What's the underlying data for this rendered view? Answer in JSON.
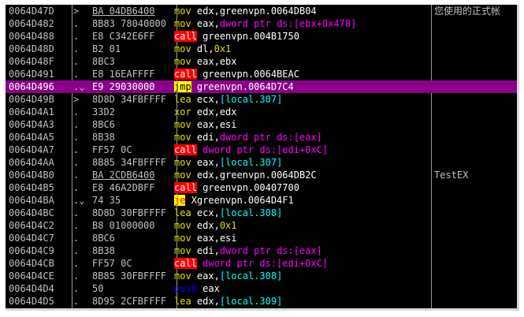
{
  "disasm": {
    "rows": [
      {
        "addr": "0064D47D",
        "mark": ">",
        "hex": "BA 04DB6400",
        "hex_ul": true,
        "op": "mov",
        "opclass": "op-y",
        "args": [
          [
            "w",
            "edx,greenvpn.0064DB04"
          ]
        ],
        "comment": "您使用的正式帐",
        "selected": false
      },
      {
        "addr": "0064D482",
        "mark": ".",
        "hex": "8B83 78040000",
        "hex_ul": false,
        "op": "mov",
        "opclass": "op-y",
        "args": [
          [
            "w",
            "eax,"
          ],
          [
            "m",
            "dword ptr ds:[ebx+0x478]"
          ]
        ],
        "comment": "",
        "selected": false
      },
      {
        "addr": "0064D488",
        "mark": ".",
        "hex": "E8 C342E6FF",
        "hex_ul": false,
        "op": "call",
        "opclass": "op-call",
        "args": [
          [
            "w",
            "greenvpn.004B1750"
          ]
        ],
        "comment": "",
        "selected": false
      },
      {
        "addr": "0064D48D",
        "mark": ".",
        "hex": "B2 01",
        "hex_ul": false,
        "op": "mov",
        "opclass": "op-y",
        "args": [
          [
            "w",
            "dl,"
          ],
          [
            "y",
            "0x1"
          ]
        ],
        "comment": "",
        "selected": false
      },
      {
        "addr": "0064D48F",
        "mark": ".",
        "hex": "8BC3",
        "hex_ul": false,
        "op": "mov",
        "opclass": "op-y",
        "args": [
          [
            "w",
            "eax,ebx"
          ]
        ],
        "comment": "",
        "selected": false
      },
      {
        "addr": "0064D491",
        "mark": ".",
        "hex": "E8 16EAFFFF",
        "hex_ul": false,
        "op": "call",
        "opclass": "op-call",
        "args": [
          [
            "w",
            "greenvpn.0064BEAC"
          ]
        ],
        "comment": "",
        "selected": false
      },
      {
        "addr": "0064D496",
        "mark": ".⌄",
        "hex": "E9 29030000",
        "hex_ul": false,
        "op": "jmp",
        "opclass": "op-jmp",
        "args": [
          [
            "w",
            "greenvpn.0064D7C4"
          ]
        ],
        "comment": "",
        "selected": true
      },
      {
        "addr": "0064D49B",
        "mark": ">",
        "hex": "8D8D 34FBFFFF",
        "hex_ul": false,
        "op": "lea",
        "opclass": "op-y",
        "args": [
          [
            "w",
            "ecx,"
          ],
          [
            "c",
            "[local.307]"
          ]
        ],
        "comment": "",
        "selected": false
      },
      {
        "addr": "0064D4A1",
        "mark": ".",
        "hex": "33D2",
        "hex_ul": false,
        "op": "xor",
        "opclass": "op-y",
        "args": [
          [
            "w",
            "edx,edx"
          ]
        ],
        "comment": "",
        "selected": false
      },
      {
        "addr": "0064D4A3",
        "mark": ".",
        "hex": "8BC6",
        "hex_ul": false,
        "op": "mov",
        "opclass": "op-y",
        "args": [
          [
            "w",
            "eax,esi"
          ]
        ],
        "comment": "",
        "selected": false
      },
      {
        "addr": "0064D4A5",
        "mark": ".",
        "hex": "8B38",
        "hex_ul": false,
        "op": "mov",
        "opclass": "op-y",
        "args": [
          [
            "w",
            "edi,"
          ],
          [
            "m",
            "dword ptr ds:[eax]"
          ]
        ],
        "comment": "",
        "selected": false
      },
      {
        "addr": "0064D4A7",
        "mark": ".",
        "hex": "FF57 0C",
        "hex_ul": false,
        "op": "call",
        "opclass": "op-call",
        "args": [
          [
            "m",
            "dword ptr ds:[edi+0xC]"
          ]
        ],
        "comment": "",
        "selected": false
      },
      {
        "addr": "0064D4AA",
        "mark": ".",
        "hex": "8B85 34FBFFFF",
        "hex_ul": false,
        "op": "mov",
        "opclass": "op-y",
        "args": [
          [
            "w",
            "eax,"
          ],
          [
            "c",
            "[local.307]"
          ]
        ],
        "comment": "",
        "selected": false
      },
      {
        "addr": "0064D4B0",
        "mark": ".",
        "hex": "BA 2CDB6400",
        "hex_ul": true,
        "op": "mov",
        "opclass": "op-y",
        "args": [
          [
            "w",
            "edx,greenvpn.0064DB2C"
          ]
        ],
        "comment": "TestEX",
        "selected": false
      },
      {
        "addr": "0064D4B5",
        "mark": ".",
        "hex": "E8 46A2DBFF",
        "hex_ul": false,
        "op": "call",
        "opclass": "op-call",
        "args": [
          [
            "w",
            "greenvpn.00407700"
          ]
        ],
        "comment": "",
        "selected": false
      },
      {
        "addr": "0064D4BA",
        "mark": ".⌄",
        "hex": "74 35",
        "hex_ul": false,
        "op": "je",
        "opclass": "op-je",
        "args": [
          [
            "w",
            "Xgreenvpn.0064D4F1"
          ]
        ],
        "comment": "",
        "selected": false
      },
      {
        "addr": "0064D4BC",
        "mark": ".",
        "hex": "8D8D 30FBFFFF",
        "hex_ul": false,
        "op": "lea",
        "opclass": "op-y",
        "args": [
          [
            "w",
            "ecx,"
          ],
          [
            "c",
            "[local.308]"
          ]
        ],
        "comment": "",
        "selected": false
      },
      {
        "addr": "0064D4C2",
        "mark": ".",
        "hex": "B8 01000000",
        "hex_ul": false,
        "op": "mov",
        "opclass": "op-y",
        "args": [
          [
            "w",
            "edx,"
          ],
          [
            "y",
            "0x1"
          ]
        ],
        "comment": "",
        "selected": false
      },
      {
        "addr": "0064D4C7",
        "mark": ".",
        "hex": "8BC6",
        "hex_ul": false,
        "op": "mov",
        "opclass": "op-y",
        "args": [
          [
            "w",
            "eax,esi"
          ]
        ],
        "comment": "",
        "selected": false
      },
      {
        "addr": "0064D4C9",
        "mark": ".",
        "hex": "8B38",
        "hex_ul": false,
        "op": "mov",
        "opclass": "op-y",
        "args": [
          [
            "w",
            "edi,"
          ],
          [
            "m",
            "dword ptr ds:[eax]"
          ]
        ],
        "comment": "",
        "selected": false
      },
      {
        "addr": "0064D4CB",
        "mark": ".",
        "hex": "FF57 0C",
        "hex_ul": false,
        "op": "call",
        "opclass": "op-call",
        "args": [
          [
            "m",
            "dword ptr ds:[edi+0xC]"
          ]
        ],
        "comment": "",
        "selected": false
      },
      {
        "addr": "0064D4CE",
        "mark": ".",
        "hex": "8B85 30FBFFFF",
        "hex_ul": false,
        "op": "mov",
        "opclass": "op-y",
        "args": [
          [
            "w",
            "eax,"
          ],
          [
            "c",
            "[local.308]"
          ]
        ],
        "comment": "",
        "selected": false
      },
      {
        "addr": "0064D4D4",
        "mark": ".",
        "hex": "50",
        "hex_ul": false,
        "op": "push",
        "opclass": "op-push",
        "args": [
          [
            "w",
            "eax"
          ]
        ],
        "comment": "",
        "selected": false
      },
      {
        "addr": "0064D4D5",
        "mark": ".",
        "hex": "8D95 2CFBFFFF",
        "hex_ul": false,
        "op": "lea",
        "opclass": "op-y",
        "args": [
          [
            "w",
            "edx,"
          ],
          [
            "c",
            "[local.309]"
          ]
        ],
        "comment": "",
        "selected": false
      }
    ]
  }
}
